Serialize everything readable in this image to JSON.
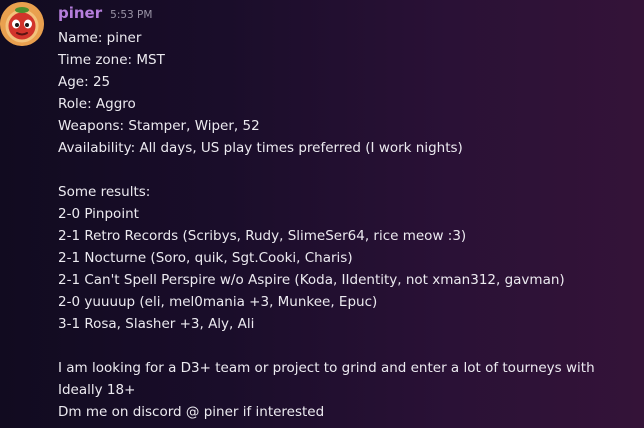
{
  "message": {
    "username": "piner",
    "timestamp": "5:53 PM",
    "avatar_icon": "tomato-face-icon",
    "lines": [
      "Name: piner",
      "Time zone: MST",
      "Age: 25",
      "Role: Aggro",
      "Weapons: Stamper, Wiper, 52",
      "Availability: All days, US play times preferred (I work nights)",
      "",
      "Some results:",
      "2-0 Pinpoint",
      "2-1 Retro Records (Scribys, Rudy, SlimeSer64, rice meow :3)",
      "2-1 Nocturne (Soro, quik, Sgt.Cooki, Charis)",
      "2-1 Can't Spell Perspire w/o Aspire (Koda, IIdentity, not xman312, gavman)",
      "2-0 yuuuup (eli, mel0mania +3, Munkee, Epuc)",
      "3-1 Rosa, Slasher +3, Aly, Ali",
      "",
      "I am looking for a D3+ team or project to grind and enter a lot of tourneys with",
      "Ideally 18+",
      "Dm me on discord @ piner if interested"
    ]
  },
  "colors": {
    "username": "#b57edc",
    "timestamp": "#9a94a6",
    "text": "#eceaf0",
    "background_left": "#110b20",
    "background_right": "#341338"
  }
}
